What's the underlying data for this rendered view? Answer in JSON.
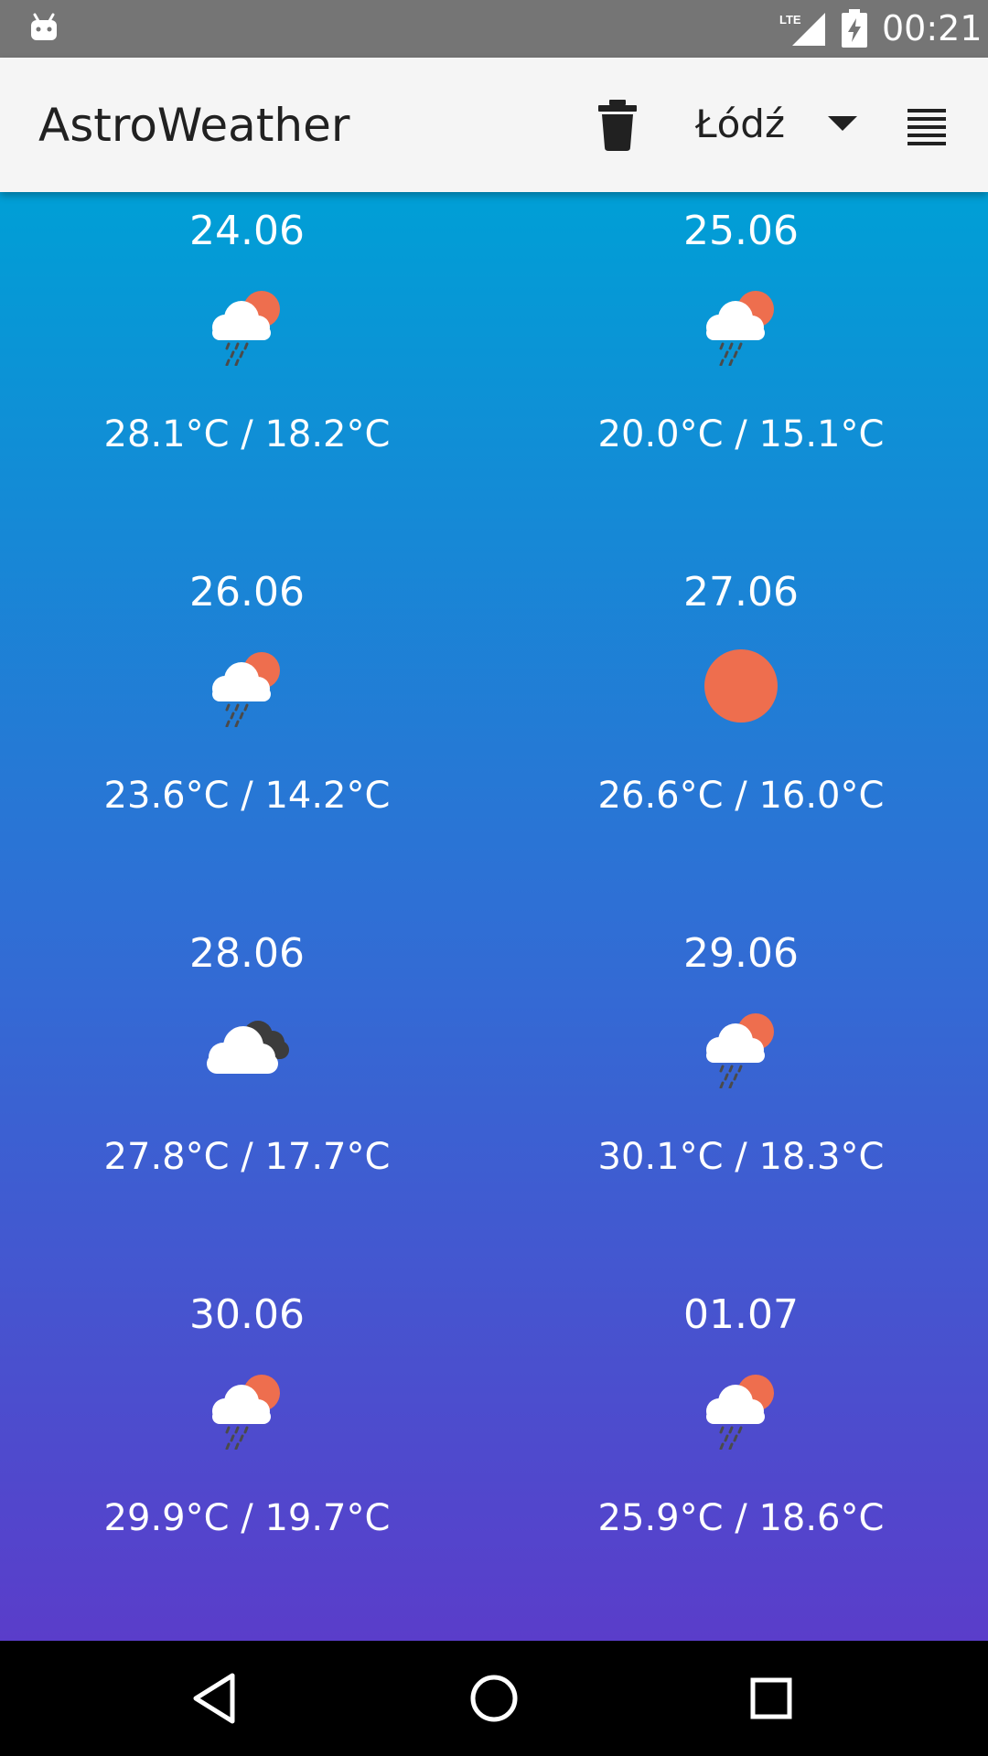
{
  "status_bar": {
    "network": "LTE",
    "time": "00:21"
  },
  "app_bar": {
    "title": "AstroWeather",
    "city": "Łódź"
  },
  "forecast": [
    {
      "date": "24.06",
      "temps": "28.1°C / 18.2°C",
      "icon": "rain-sun-icon"
    },
    {
      "date": "25.06",
      "temps": "20.0°C / 15.1°C",
      "icon": "rain-sun-icon"
    },
    {
      "date": "26.06",
      "temps": "23.6°C / 14.2°C",
      "icon": "rain-sun-icon"
    },
    {
      "date": "27.06",
      "temps": "26.6°C / 16.0°C",
      "icon": "sun-icon"
    },
    {
      "date": "28.06",
      "temps": "27.8°C / 17.7°C",
      "icon": "cloudy-icon"
    },
    {
      "date": "29.06",
      "temps": "30.1°C / 18.3°C",
      "icon": "rain-sun-icon"
    },
    {
      "date": "30.06",
      "temps": "29.9°C / 19.7°C",
      "icon": "rain-sun-icon"
    },
    {
      "date": "01.07",
      "temps": "25.9°C / 18.6°C",
      "icon": "rain-sun-icon"
    }
  ],
  "colors": {
    "status_bar": "#757575",
    "app_bar": "#f5f5f5",
    "gradient_top": "#009fd6",
    "gradient_bottom": "#5a3dca",
    "sun": "#ee6e4e"
  }
}
